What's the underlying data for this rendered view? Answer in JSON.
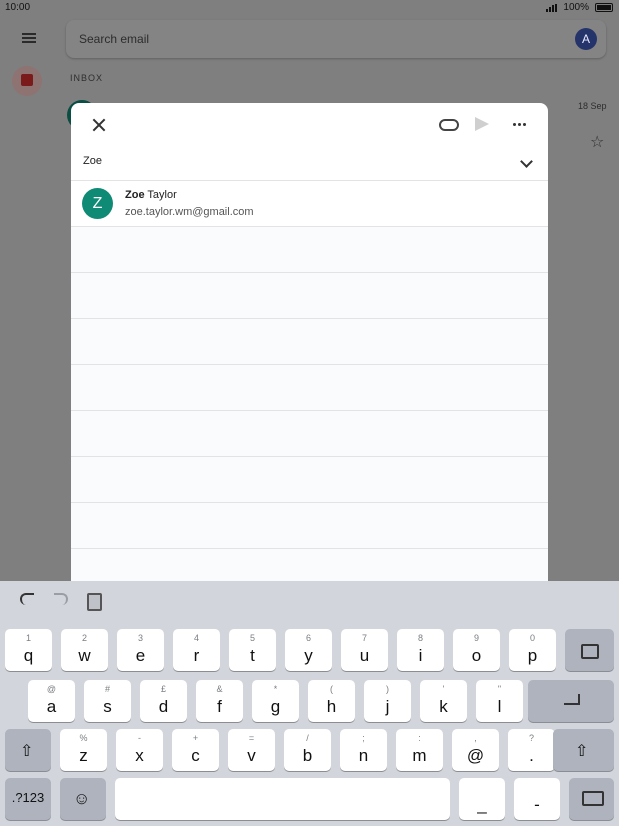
{
  "status": {
    "time": "10:00",
    "battery": "100%"
  },
  "background": {
    "search_placeholder": "Search email",
    "avatar_letter": "A",
    "inbox_label": "INBOX",
    "date": "18 Sep"
  },
  "compose": {
    "to_value": "Zoe",
    "suggestion": {
      "avatar_letter": "Z",
      "first": "Zoe",
      "last": "Taylor",
      "email": "zoe.taylor.wm@gmail.com"
    }
  },
  "keyboard": {
    "row1": [
      {
        "p": "q",
        "s": "1"
      },
      {
        "p": "w",
        "s": "2"
      },
      {
        "p": "e",
        "s": "3"
      },
      {
        "p": "r",
        "s": "4"
      },
      {
        "p": "t",
        "s": "5"
      },
      {
        "p": "y",
        "s": "6"
      },
      {
        "p": "u",
        "s": "7"
      },
      {
        "p": "i",
        "s": "8"
      },
      {
        "p": "o",
        "s": "9"
      },
      {
        "p": "p",
        "s": "0"
      }
    ],
    "row2": [
      {
        "p": "a",
        "s": "@"
      },
      {
        "p": "s",
        "s": "#"
      },
      {
        "p": "d",
        "s": "£"
      },
      {
        "p": "f",
        "s": "&"
      },
      {
        "p": "g",
        "s": "*"
      },
      {
        "p": "h",
        "s": "("
      },
      {
        "p": "j",
        "s": ")"
      },
      {
        "p": "k",
        "s": "'"
      },
      {
        "p": "l",
        "s": "\""
      }
    ],
    "row3": [
      {
        "p": "z",
        "s": "%"
      },
      {
        "p": "x",
        "s": "-"
      },
      {
        "p": "c",
        "s": "+"
      },
      {
        "p": "v",
        "s": "="
      },
      {
        "p": "b",
        "s": "/"
      },
      {
        "p": "n",
        "s": ";"
      },
      {
        "p": "m",
        "s": ":"
      },
      {
        "p": "@",
        "s": ","
      },
      {
        "p": ".",
        "s": "?"
      }
    ],
    "numbers_label": ".?123",
    "underscore": "_",
    "dash": "-"
  }
}
